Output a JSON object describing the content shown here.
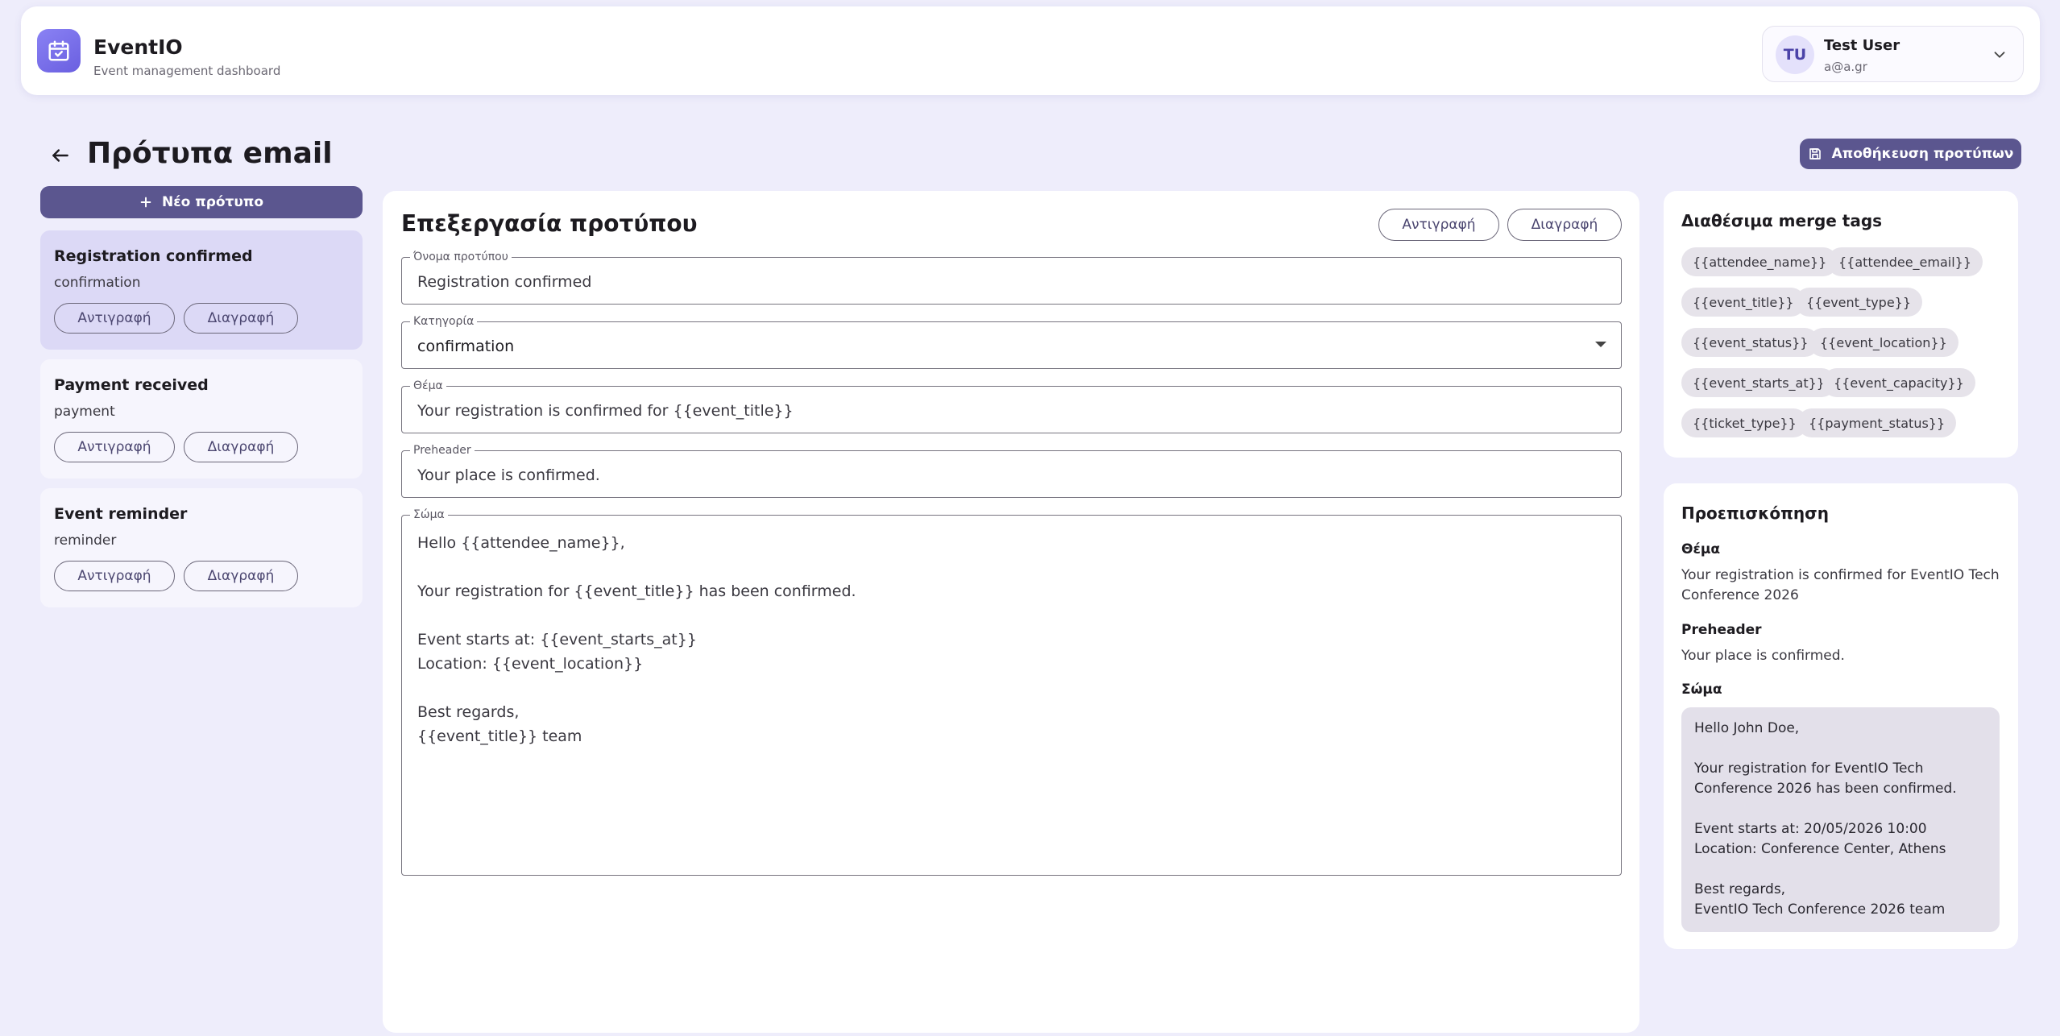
{
  "app": {
    "name": "EventIO",
    "subtitle": "Event management dashboard"
  },
  "user": {
    "initials": "TU",
    "name": "Test User",
    "email": "a@a.gr"
  },
  "page": {
    "title": "Πρότυπα email",
    "save_label": "Αποθήκευση προτύπων",
    "new_label": "Νέο πρότυπο"
  },
  "templates": [
    {
      "name": "Registration confirmed",
      "category": "confirmation",
      "copy_label": "Αντιγραφή",
      "delete_label": "Διαγραφή"
    },
    {
      "name": "Payment received",
      "category": "payment",
      "copy_label": "Αντιγραφή",
      "delete_label": "Διαγραφή"
    },
    {
      "name": "Event reminder",
      "category": "reminder",
      "copy_label": "Αντιγραφή",
      "delete_label": "Διαγραφή"
    }
  ],
  "editor": {
    "title": "Επεξεργασία προτύπου",
    "copy_label": "Αντιγραφή",
    "delete_label": "Διαγραφή",
    "fields": {
      "name": {
        "label": "Όνομα προτύπου",
        "value": "Registration confirmed"
      },
      "category": {
        "label": "Κατηγορία",
        "value": "confirmation"
      },
      "subject": {
        "label": "Θέμα",
        "value": "Your registration is confirmed for {{event_title}}"
      },
      "preheader": {
        "label": "Preheader",
        "value": "Your place is confirmed."
      },
      "body": {
        "label": "Σώμα",
        "lines": [
          "Hello {{attendee_name}},",
          "",
          "Your registration for {{event_title}} has been confirmed.",
          "",
          "Event starts at: {{event_starts_at}}",
          "Location: {{event_location}}",
          "",
          "Best regards,",
          "{{event_title}} team"
        ]
      }
    }
  },
  "merge_tags": {
    "title": "Διαθέσιμα merge tags",
    "tags": [
      "{{attendee_name}}",
      "{{attendee_email}}",
      "{{event_title}}",
      "{{event_type}}",
      "{{event_status}}",
      "{{event_location}}",
      "{{event_starts_at}}",
      "{{event_capacity}}",
      "{{ticket_type}}",
      "{{payment_status}}"
    ]
  },
  "preview": {
    "title": "Προεπισκόπηση",
    "subject_label": "Θέμα",
    "subject_lines": [
      "Your registration is confirmed for EventIO Tech",
      "Conference 2026"
    ],
    "preheader_label": "Preheader",
    "preheader": "Your place is confirmed.",
    "body_label": "Σώμα",
    "body_lines": [
      "Hello John Doe,",
      "",
      "Your registration for EventIO Tech",
      "Conference 2026 has been confirmed.",
      "",
      "Event starts at: 20/05/2026 10:00",
      "Location: Conference Center, Athens",
      "",
      "Best regards,",
      "EventIO Tech Conference 2026 team"
    ]
  }
}
